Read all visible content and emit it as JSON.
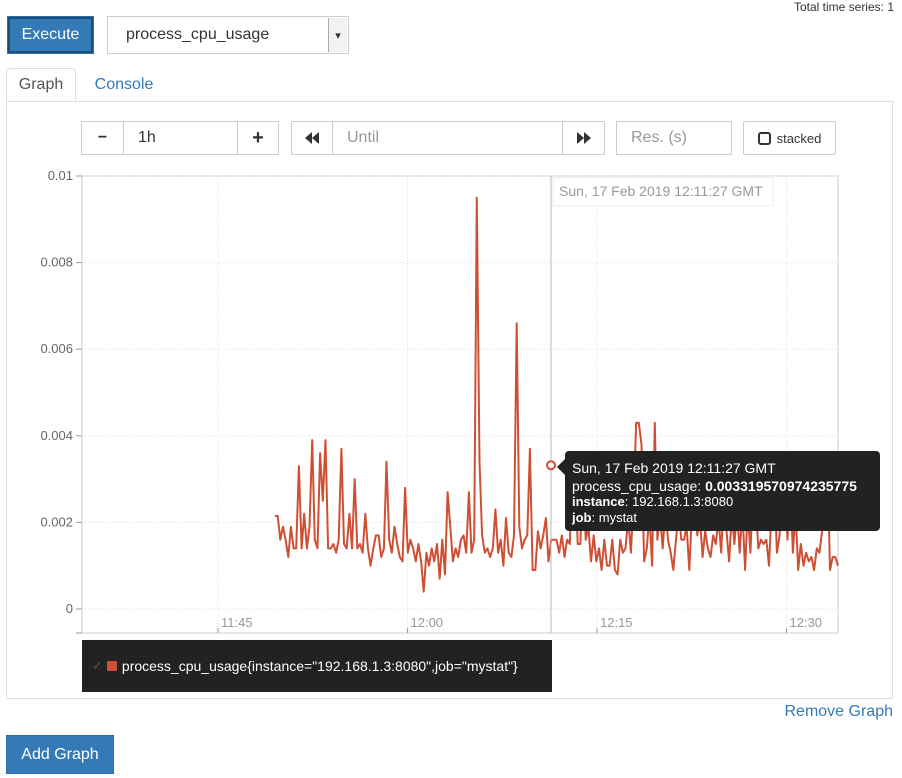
{
  "header": {
    "total_series_label": "Total time series: 1",
    "execute_label": "Execute",
    "metric_value": "process_cpu_usage"
  },
  "tabs": [
    {
      "label": "Graph",
      "active": true
    },
    {
      "label": "Console",
      "active": false
    }
  ],
  "controls": {
    "range_minus": "−",
    "range_value": "1h",
    "range_plus": "+",
    "until_back": "⏪",
    "until_placeholder": "Until",
    "until_forward": "⏩",
    "resolution_placeholder": "Res. (s)",
    "stacked_label": "stacked"
  },
  "chart_data": {
    "type": "line",
    "y_ticks": [
      "0.01",
      "0.008",
      "0.006",
      "0.004",
      "0.002",
      "0"
    ],
    "ylim": [
      0,
      0.01
    ],
    "x_ticks": [
      "11:45",
      "12:00",
      "12:15",
      "12:30"
    ],
    "grid": true,
    "hover_time_label": "Sun, 17 Feb 2019 12:11:27 GMT",
    "series": [
      {
        "name": "process_cpu_usage{instance=\"192.168.1.3:8080\",job=\"mystat\"}",
        "color": "#cf4f35",
        "values": [
          0.00215,
          0.00215,
          0.0016,
          0.0019,
          0.0016,
          0.0012,
          0.0019,
          0.0014,
          0.0014,
          0.0033,
          0.0014,
          0.0022,
          0.0014,
          0.0019,
          0.0039,
          0.0016,
          0.0014,
          0.0036,
          0.0025,
          0.0039,
          0.0014,
          0.0014,
          0.0015,
          0.0013,
          0.0016,
          0.0037,
          0.0015,
          0.0014,
          0.0022,
          0.0014,
          0.003,
          0.0014,
          0.0015,
          0.0013,
          0.0022,
          0.0014,
          0.001,
          0.0014,
          0.0017,
          0.0017,
          0.0012,
          0.0014,
          0.0034,
          0.0016,
          0.0013,
          0.0019,
          0.0015,
          0.0012,
          0.0011,
          0.0028,
          0.0013,
          0.0016,
          0.0014,
          0.0011,
          0.0015,
          0.0011,
          0.0004,
          0.0013,
          0.001,
          0.0014,
          0.0011,
          0.0015,
          0.0007,
          0.0016,
          0.0008,
          0.0027,
          0.0019,
          0.0011,
          0.0014,
          0.0012,
          0.0016,
          0.0017,
          0.0013,
          0.0027,
          0.0013,
          0.0016,
          0.0095,
          0.0034,
          0.0017,
          0.0013,
          0.0014,
          0.0012,
          0.0014,
          0.0023,
          0.0013,
          0.0016,
          0.001,
          0.0021,
          0.0013,
          0.0012,
          0.0017,
          0.0066,
          0.0019,
          0.0014,
          0.0016,
          0.0017,
          0.0037,
          0.0009,
          0.0009,
          0.0018,
          0.0014,
          0.0017,
          0.0021,
          0.0011,
          0.0016,
          0.0016,
          0.0016,
          0.0013,
          0.0017,
          0.0012,
          0.0016,
          0.0015,
          0.0033,
          0.0033,
          0.0015,
          0.0015,
          0.0035,
          0.0016,
          0.0019,
          0.0011,
          0.0017,
          0.0011,
          0.0014,
          0.0009,
          0.0016,
          0.001,
          0.001,
          0.0016,
          0.0009,
          0.0008,
          0.0016,
          0.0013,
          0.0014,
          0.0021,
          0.0013,
          0.0025,
          0.0043,
          0.0043,
          0.0038,
          0.0011,
          0.0014,
          0.0022,
          0.001,
          0.0043,
          0.0016,
          0.0022,
          0.0014,
          0.0023,
          0.0016,
          0.0013,
          0.0009,
          0.0016,
          0.0023,
          0.0016,
          0.0016,
          0.0019,
          0.0009,
          0.0022,
          0.003,
          0.0017,
          0.0021,
          0.0012,
          0.0018,
          0.0014,
          0.0012,
          0.0017,
          0.0015,
          0.0021,
          0.0013,
          0.0026,
          0.0018,
          0.0011,
          0.0022,
          0.0015,
          0.0023,
          0.0013,
          0.0023,
          0.0009,
          0.0023,
          0.0013,
          0.0027,
          0.0025,
          0.0014,
          0.0016,
          0.0015,
          0.0016,
          0.001,
          0.0023,
          0.003,
          0.0013,
          0.0017,
          0.0034,
          0.0029,
          0.0016,
          0.0029,
          0.0013,
          0.0023,
          0.0009,
          0.0015,
          0.001,
          0.0013,
          0.0011,
          0.0012,
          0.0009,
          0.0014,
          0.0013,
          0.0018,
          0.0025,
          0.0035,
          0.0009,
          0.0012,
          0.0012,
          0.001
        ]
      }
    ],
    "hover": {
      "time": "Sun, 17 Feb 2019 12:11:27 GMT",
      "metric_label": "process_cpu_usage:",
      "value": "0.003319570974235775",
      "instance_label": "instance",
      "instance_value": "192.168.1.3:8080",
      "job_label": "job",
      "job_value": "mystat"
    }
  },
  "legend": {
    "check": "✓",
    "series_label": "process_cpu_usage{instance=\"192.168.1.3:8080\",job=\"mystat\"}"
  },
  "footer": {
    "remove_graph": "Remove Graph",
    "add_graph": "Add Graph"
  }
}
